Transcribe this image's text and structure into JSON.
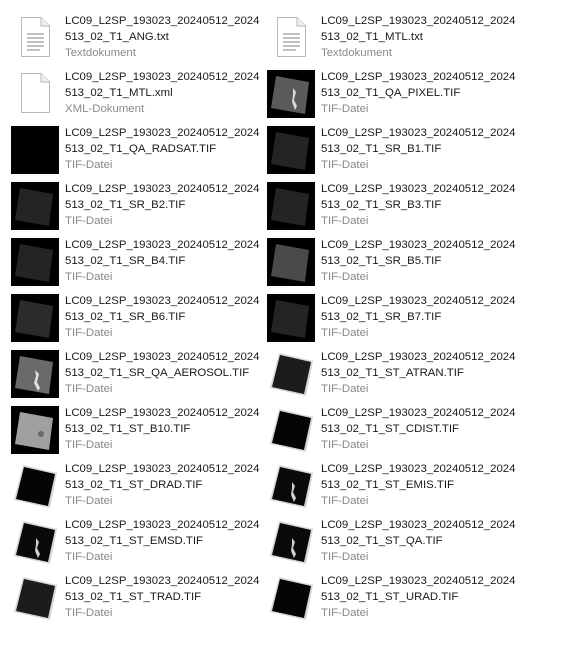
{
  "window": {
    "view": "explorer-tiles"
  },
  "files": [
    {
      "line1": "LC09_L2SP_193023_20240512_20240",
      "line2": "513_02_T1_ANG.txt",
      "type": "Textdokument",
      "icon": "text-document-icon",
      "kind": "txt"
    },
    {
      "line1": "LC09_L2SP_193023_20240512_20240",
      "line2": "513_02_T1_MTL.txt",
      "type": "Textdokument",
      "icon": "text-document-icon",
      "kind": "txt"
    },
    {
      "line1": "LC09_L2SP_193023_20240512_20240",
      "line2": "513_02_T1_MTL.xml",
      "type": "XML-Dokument",
      "icon": "xml-document-icon",
      "kind": "xml"
    },
    {
      "line1": "LC09_L2SP_193023_20240512_20240",
      "line2": "513_02_T1_QA_PIXEL.TIF",
      "type": "TIF-Datei",
      "icon": "satellite-thumbnail-icon",
      "kind": "qapixel"
    },
    {
      "line1": "LC09_L2SP_193023_20240512_20240",
      "line2": "513_02_T1_QA_RADSAT.TIF",
      "type": "TIF-Datei",
      "icon": "black-thumbnail-icon",
      "kind": "black"
    },
    {
      "line1": "LC09_L2SP_193023_20240512_20240",
      "line2": "513_02_T1_SR_B1.TIF",
      "type": "TIF-Datei",
      "icon": "satellite-thumbnail-icon",
      "kind": "dark"
    },
    {
      "line1": "LC09_L2SP_193023_20240512_20240",
      "line2": "513_02_T1_SR_B2.TIF",
      "type": "TIF-Datei",
      "icon": "satellite-thumbnail-icon",
      "kind": "dark"
    },
    {
      "line1": "LC09_L2SP_193023_20240512_20240",
      "line2": "513_02_T1_SR_B3.TIF",
      "type": "TIF-Datei",
      "icon": "satellite-thumbnail-icon",
      "kind": "dark"
    },
    {
      "line1": "LC09_L2SP_193023_20240512_20240",
      "line2": "513_02_T1_SR_B4.TIF",
      "type": "TIF-Datei",
      "icon": "satellite-thumbnail-icon",
      "kind": "dark"
    },
    {
      "line1": "LC09_L2SP_193023_20240512_20240",
      "line2": "513_02_T1_SR_B5.TIF",
      "type": "TIF-Datei",
      "icon": "satellite-thumbnail-icon",
      "kind": "mid"
    },
    {
      "line1": "LC09_L2SP_193023_20240512_20240",
      "line2": "513_02_T1_SR_B6.TIF",
      "type": "TIF-Datei",
      "icon": "satellite-thumbnail-icon",
      "kind": "dark2"
    },
    {
      "line1": "LC09_L2SP_193023_20240512_20240",
      "line2": "513_02_T1_SR_B7.TIF",
      "type": "TIF-Datei",
      "icon": "satellite-thumbnail-icon",
      "kind": "dark"
    },
    {
      "line1": "LC09_L2SP_193023_20240512_20240",
      "line2": "513_02_T1_SR_QA_AEROSOL.TIF",
      "type": "TIF-Datei",
      "icon": "satellite-thumbnail-icon",
      "kind": "aerosol"
    },
    {
      "line1": "LC09_L2SP_193023_20240512_20240",
      "line2": "513_02_T1_ST_ATRAN.TIF",
      "type": "TIF-Datei",
      "icon": "satellite-thumbnail-icon",
      "kind": "whiteframe-dark"
    },
    {
      "line1": "LC09_L2SP_193023_20240512_20240",
      "line2": "513_02_T1_ST_B10.TIF",
      "type": "TIF-Datei",
      "icon": "satellite-thumbnail-icon",
      "kind": "bright"
    },
    {
      "line1": "LC09_L2SP_193023_20240512_20240",
      "line2": "513_02_T1_ST_CDIST.TIF",
      "type": "TIF-Datei",
      "icon": "satellite-thumbnail-icon",
      "kind": "whiteframe-black"
    },
    {
      "line1": "LC09_L2SP_193023_20240512_20240",
      "line2": "513_02_T1_ST_DRAD.TIF",
      "type": "TIF-Datei",
      "icon": "satellite-thumbnail-icon",
      "kind": "whiteframe-black"
    },
    {
      "line1": "LC09_L2SP_193023_20240512_20240",
      "line2": "513_02_T1_ST_EMIS.TIF",
      "type": "TIF-Datei",
      "icon": "satellite-thumbnail-icon",
      "kind": "whiteframe-emis"
    },
    {
      "line1": "LC09_L2SP_193023_20240512_20240",
      "line2": "513_02_T1_ST_EMSD.TIF",
      "type": "TIF-Datei",
      "icon": "satellite-thumbnail-icon",
      "kind": "whiteframe-emis"
    },
    {
      "line1": "LC09_L2SP_193023_20240512_20240",
      "line2": "513_02_T1_ST_QA.TIF",
      "type": "TIF-Datei",
      "icon": "satellite-thumbnail-icon",
      "kind": "whiteframe-emis"
    },
    {
      "line1": "LC09_L2SP_193023_20240512_20240",
      "line2": "513_02_T1_ST_TRAD.TIF",
      "type": "TIF-Datei",
      "icon": "satellite-thumbnail-icon",
      "kind": "whiteframe-dark"
    },
    {
      "line1": "LC09_L2SP_193023_20240512_20240",
      "line2": "513_02_T1_ST_URAD.TIF",
      "type": "TIF-Datei",
      "icon": "satellite-thumbnail-icon",
      "kind": "whiteframe-black"
    }
  ]
}
